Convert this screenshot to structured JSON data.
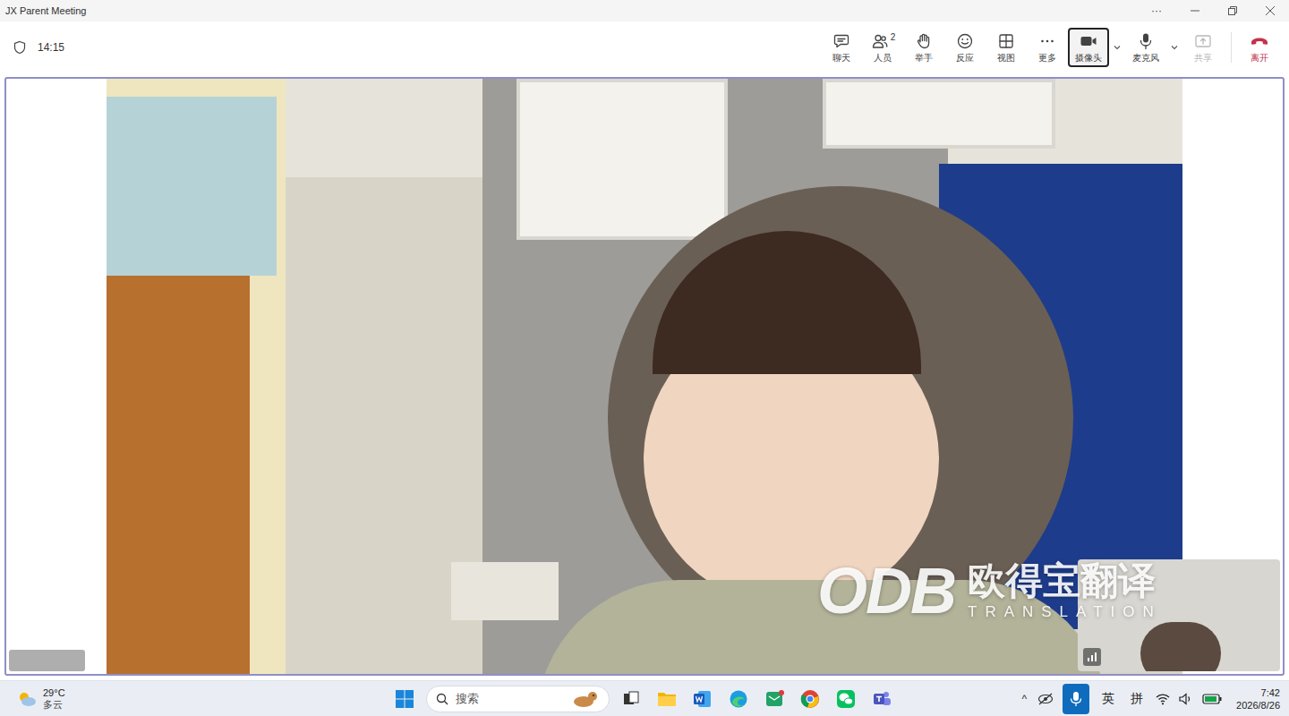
{
  "window": {
    "title": "JX Parent Meeting",
    "more": "···"
  },
  "meeting": {
    "elapsed": "14:15"
  },
  "toolbar": [
    {
      "label": "聊天",
      "kind": "button",
      "selected": false,
      "disabled": false,
      "menu": false
    },
    {
      "label": "人员",
      "badge": "2",
      "kind": "button",
      "selected": false,
      "disabled": false,
      "menu": false
    },
    {
      "label": "举手",
      "kind": "button",
      "selected": false,
      "disabled": false,
      "menu": false
    },
    {
      "label": "反应",
      "kind": "button",
      "selected": false,
      "disabled": false,
      "menu": false
    },
    {
      "label": "视图",
      "kind": "button",
      "selected": false,
      "disabled": false,
      "menu": false
    },
    {
      "label": "更多",
      "kind": "button",
      "selected": false,
      "disabled": false,
      "menu": false
    },
    {
      "label": "摄像头",
      "kind": "button",
      "selected": true,
      "disabled": false,
      "menu": true
    },
    {
      "label": "麦克风",
      "kind": "button",
      "selected": false,
      "disabled": false,
      "menu": true
    },
    {
      "label": "共享",
      "kind": "button",
      "selected": false,
      "disabled": true,
      "menu": false
    },
    {
      "label": "离开",
      "kind": "leave",
      "selected": false,
      "disabled": false,
      "menu": false
    }
  ],
  "stage": {
    "watermark": {
      "logo": "ODB",
      "name": "欧得宝翻译",
      "sub": "TRANSLATION"
    }
  },
  "taskbar": {
    "weather": {
      "temp": "29°C",
      "desc": "多云"
    },
    "search": "搜索",
    "tray": {
      "overflow": "^",
      "mic_active": true,
      "ime": [
        "英",
        "拼"
      ]
    },
    "clock": {
      "time": "7:42",
      "date": "2026/8/26"
    }
  }
}
